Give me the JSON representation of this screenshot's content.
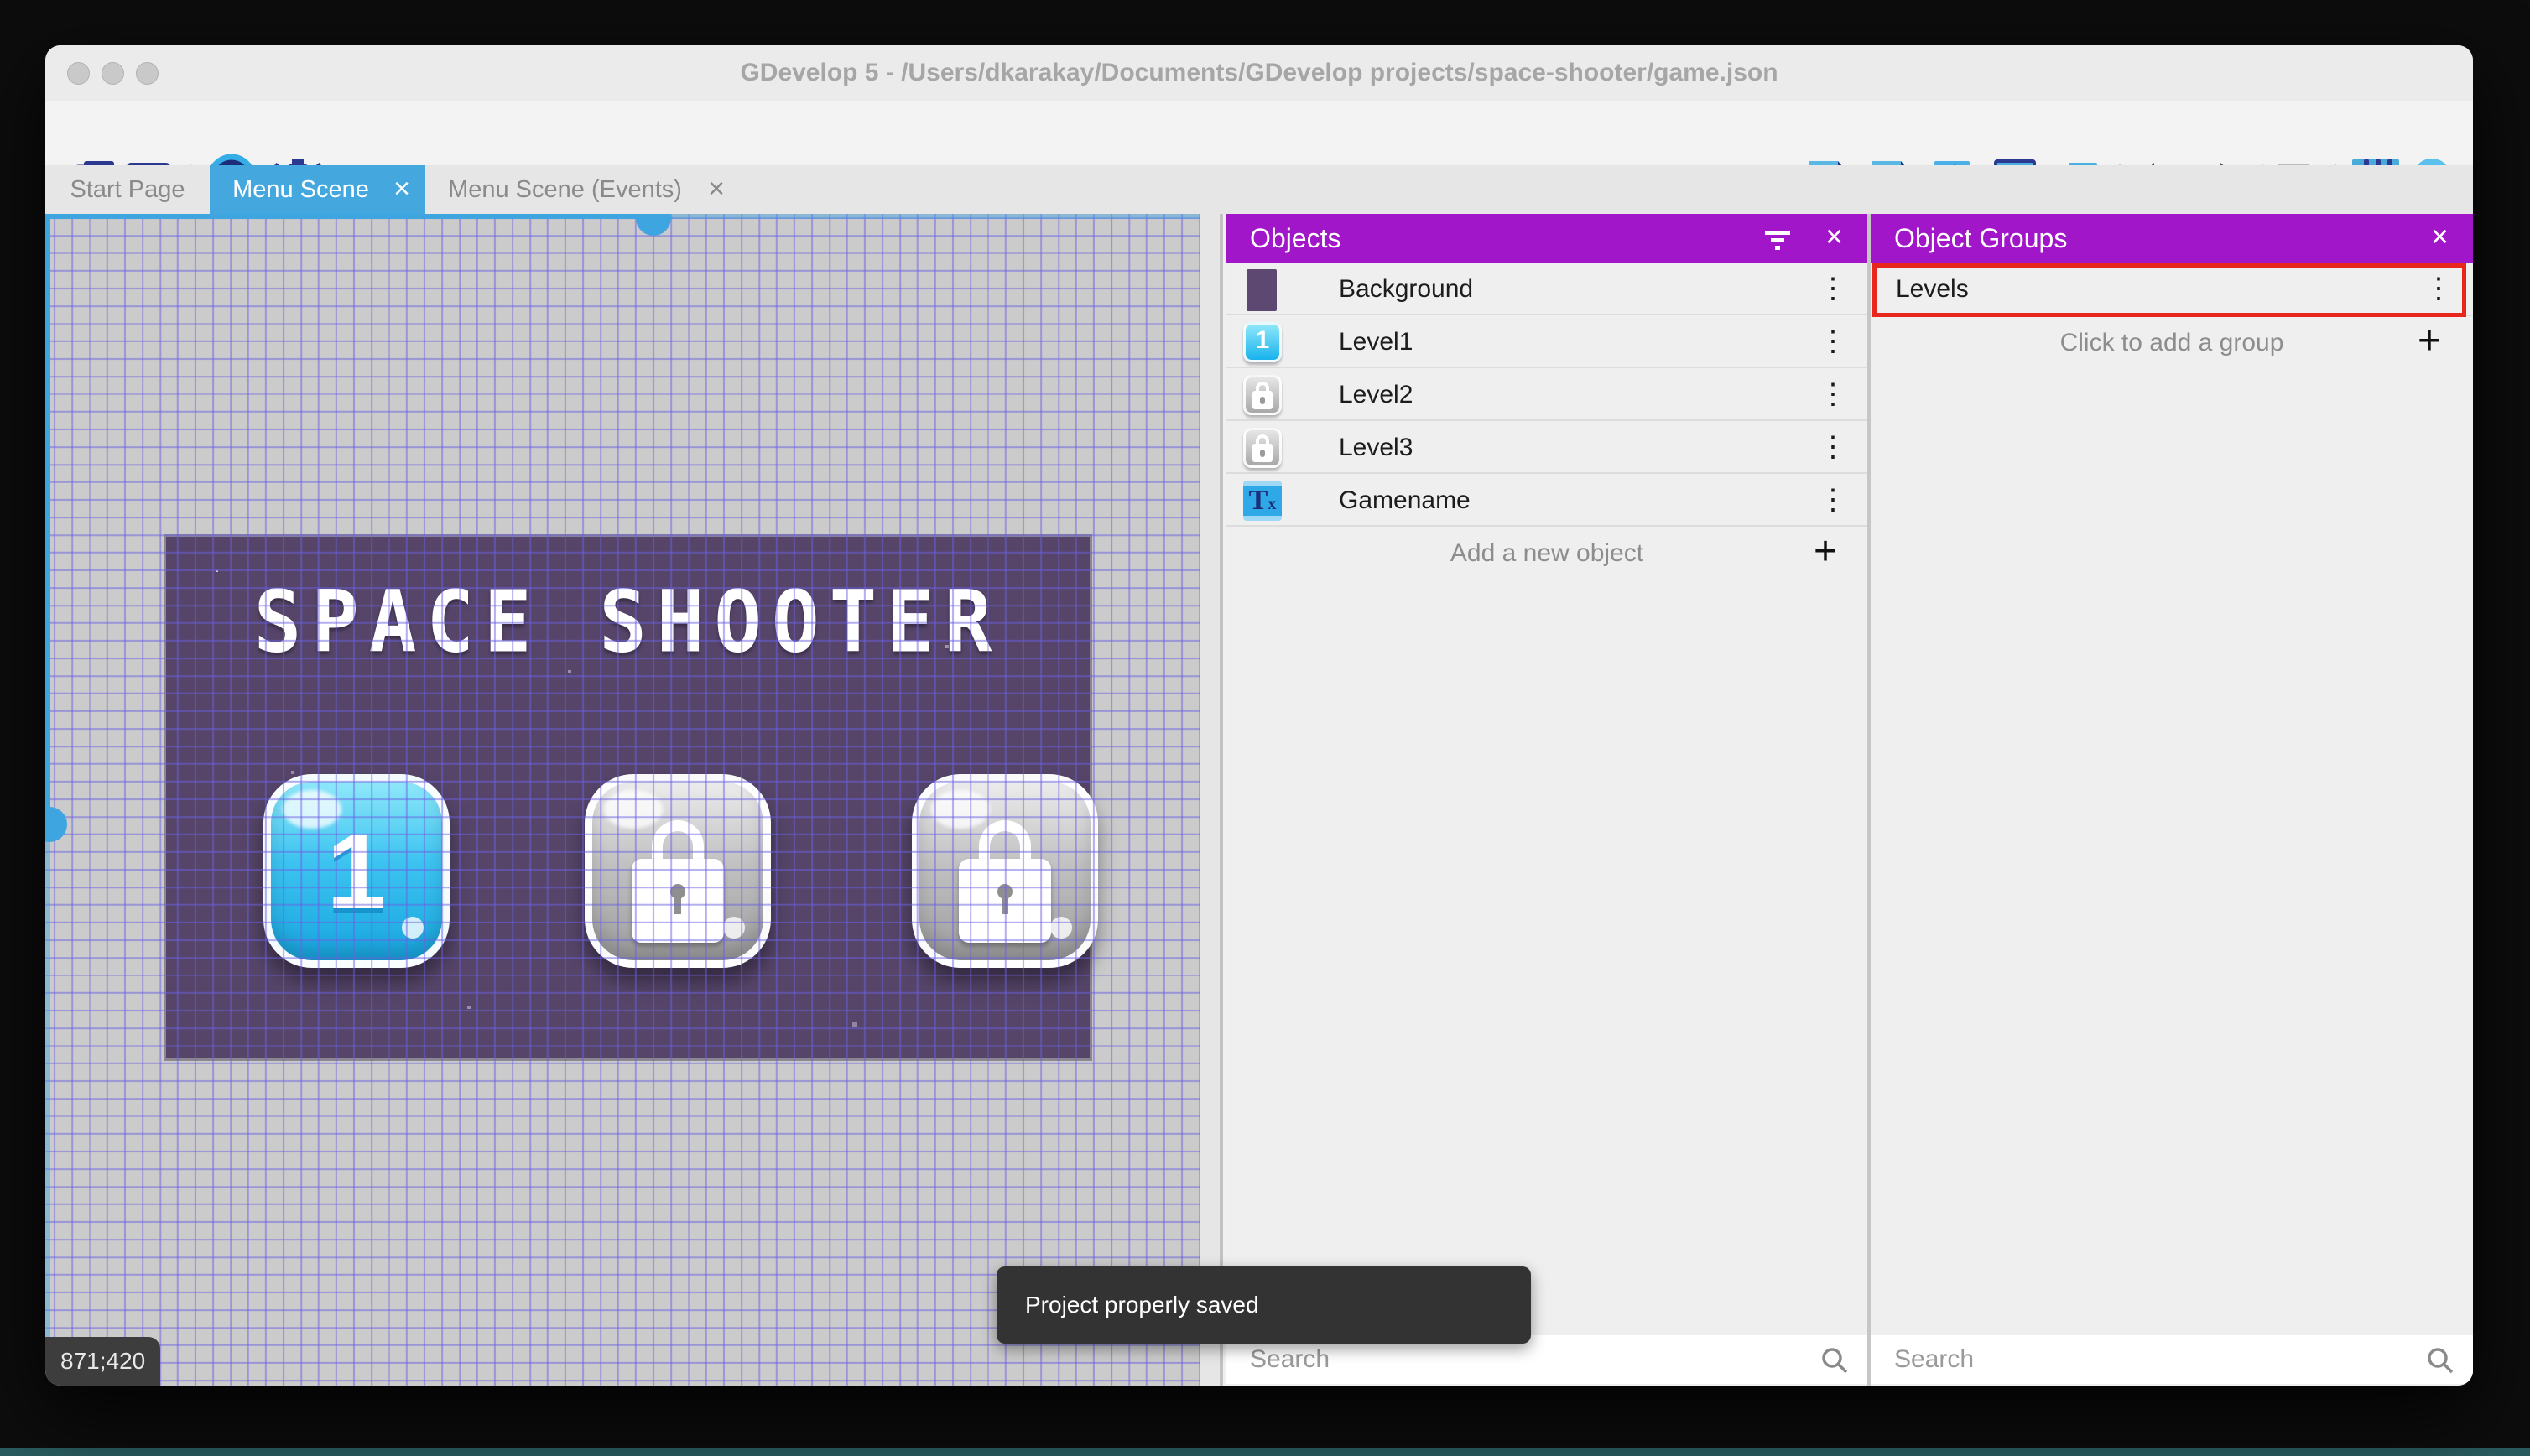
{
  "window": {
    "title": "GDevelop 5 - /Users/dkarakay/Documents/GDevelop projects/space-shooter/game.json"
  },
  "ui": {
    "close_glyph": "×",
    "dots_glyph": "⋮",
    "plus_glyph": "+"
  },
  "toolbar": {
    "left_icons": [
      "project-manager-icon",
      "scene-window-icon",
      "play-preview-icon",
      "debug-icon"
    ],
    "right_icons": [
      "objects-editor-icon",
      "object-groups-editor-icon",
      "properties-icon",
      "instances-list-icon",
      "layers-editor-icon",
      "undo-icon",
      "redo-icon",
      "mask-icon",
      "grid-icon",
      "zoom-1:1-icon"
    ]
  },
  "tabs": [
    {
      "label": "Start Page"
    },
    {
      "label": "Menu Scene",
      "active": true,
      "close": "×"
    },
    {
      "label": "Menu Scene (Events)",
      "close": "×"
    }
  ],
  "canvas": {
    "coordinates": "871;420",
    "game_title": "SPACE SHOOTER",
    "level_buttons": [
      {
        "label": "1",
        "state": "unlocked"
      },
      {
        "state": "locked"
      },
      {
        "state": "locked"
      }
    ]
  },
  "objects_panel": {
    "title": "Objects",
    "items": [
      {
        "label": "Background",
        "icon": "background-thumbnail"
      },
      {
        "label": "Level1",
        "icon": "level-button-unlocked"
      },
      {
        "label": "Level2",
        "icon": "level-button-locked"
      },
      {
        "label": "Level3",
        "icon": "level-button-locked"
      },
      {
        "label": "Gamename",
        "icon": "text-object"
      }
    ],
    "add_label": "Add a new object",
    "search_placeholder": "Search"
  },
  "groups_panel": {
    "title": "Object Groups",
    "items": [
      {
        "label": "Levels",
        "highlighted": true
      }
    ],
    "add_label": "Click to add a group",
    "search_placeholder": "Search"
  },
  "snackbar": {
    "message": "Project properly saved"
  },
  "colors": {
    "accent_blue": "#44a8df",
    "panel_header_purple": "#a116c9",
    "highlight_red": "#e8261c",
    "snackbar_bg": "#333333",
    "grid_line": "#6a60e2",
    "game_panel_purple": "#564569"
  }
}
